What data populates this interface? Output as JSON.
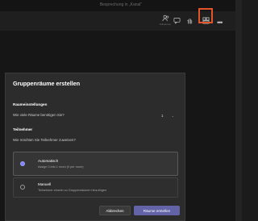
{
  "window": {
    "title": "Besprechung in „Kanal\""
  },
  "toolbar": {
    "items": [
      {
        "icon": "people-icon",
        "caption": "Teilnehmer"
      },
      {
        "icon": "chat-icon",
        "caption": ""
      },
      {
        "icon": "hand-icon",
        "caption": ""
      },
      {
        "icon": "breakout-rooms-icon",
        "caption": ""
      }
    ],
    "more_label": "•••",
    "highlight_color": "#e2552a"
  },
  "dialog": {
    "title": "Gruppenräume erstellen",
    "room_settings": {
      "heading": "Raumeinstellungen",
      "question": "Wie viele Räume benötigen Sie?",
      "count": "1",
      "chevron": "⌄"
    },
    "participants": {
      "heading": "Teilnehmer",
      "question": "Wie möchten Sie Teilnehmer zuweisen?",
      "options": [
        {
          "label": "Automatisch",
          "sub": "Assign 0 into 1 room (0 per room)",
          "selected": true
        },
        {
          "label": "Manuell",
          "sub": "Teilnehmer einzeln zu Gruppenräumen hinzufügen",
          "selected": false
        }
      ]
    },
    "buttons": {
      "cancel": "Abbrechen",
      "create": "Räume erstellen"
    },
    "accent_color": "#6264a7"
  }
}
